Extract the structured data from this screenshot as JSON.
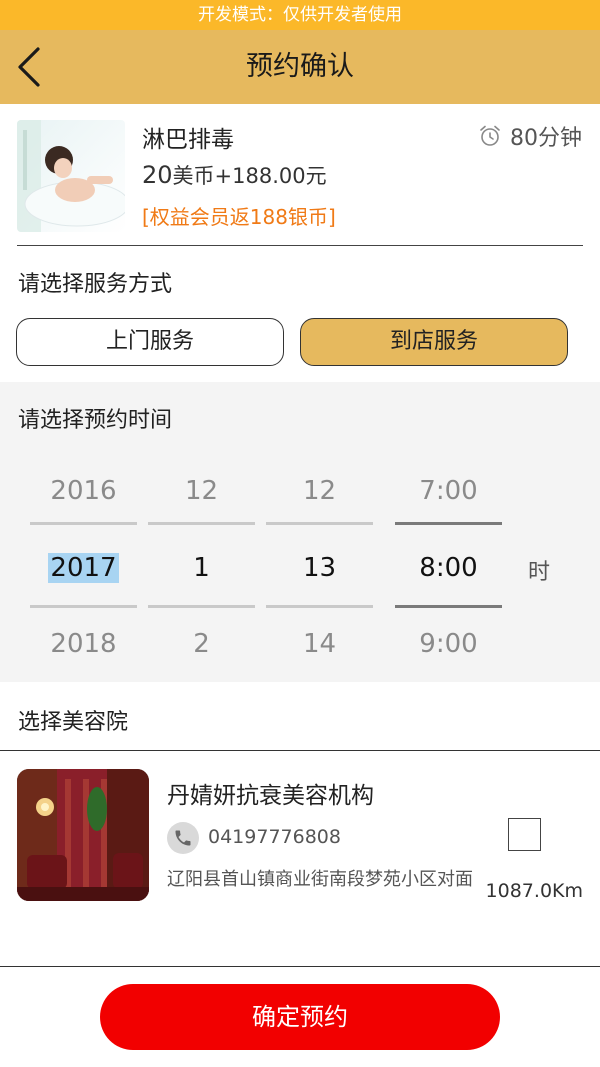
{
  "dev_banner": "开发模式：仅供开发者使用",
  "header": {
    "title": "预约确认"
  },
  "product": {
    "name": "淋巴排毒",
    "duration": "80分钟",
    "price_amount": "20",
    "price_rest": "美币+188.00元",
    "note": "[权益会员返188银币]"
  },
  "service": {
    "title": "请选择服务方式",
    "options": [
      "上门服务",
      "到店服务"
    ],
    "selected": "到店服务"
  },
  "time": {
    "title": "请选择预约时间",
    "year": {
      "prev": "2016",
      "current": "2017",
      "next": "2018"
    },
    "month": {
      "prev": "12",
      "current": "1",
      "next": "2"
    },
    "day": {
      "prev": "12",
      "current": "13",
      "next": "14"
    },
    "hour": {
      "prev": "7:00",
      "current": "8:00",
      "next": "9:00"
    },
    "hour_unit": "时"
  },
  "salon": {
    "section_title": "选择美容院",
    "name": "丹婧妍抗衰美容机构",
    "phone": "04197776808",
    "address": "辽阳县首山镇商业街南段梦苑小区对面",
    "distance": "1087.0Km",
    "checked": false
  },
  "confirm_label": "确定预约",
  "colors": {
    "accent": "#e6b95e",
    "dev_bar": "#fbb829",
    "note": "#f07a16",
    "confirm": "#f20000"
  }
}
